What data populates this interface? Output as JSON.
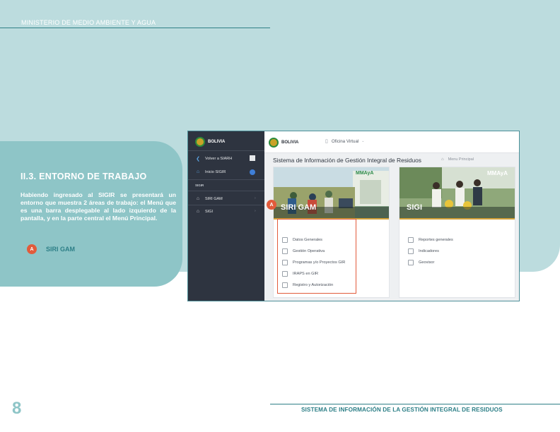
{
  "header": {
    "ministry": "MINISTERIO DE MEDIO AMBIENTE Y AGUA"
  },
  "section": {
    "title": "II.3. ENTORNO DE TRABAJO",
    "body": "Habiendo ingresado al SIGIR se presentará un entorno que muestra 2 áreas de trabajo: el Menú que es una barra desplegable al lado izquierdo de la pantalla, y en la parte central el Menú Principal.",
    "legend": {
      "badge": "A",
      "label": "SIRI GAM"
    }
  },
  "screenshot": {
    "sidebar": {
      "logo_word": "BOLIVIA",
      "back": "Volver a SIARH",
      "home": "Inicio SIGIR",
      "section_label": "SIGIR",
      "items": [
        "SIRI GAM",
        "SIGI"
      ]
    },
    "topbar": {
      "logo_word": "BOLIVIA",
      "office": "Oficina Virtual"
    },
    "title": "Sistema de Información de Gestión Integral de Residuos",
    "breadcrumb": "Menu Principal",
    "cards": [
      {
        "label": "SIRI GAM",
        "brand": "MMAyA",
        "items": [
          "Datos Generales",
          "Gestión Operativa",
          "Programas y/o Proyectos GIR",
          "IRAPS en GIR",
          "Registro y Autorización"
        ]
      },
      {
        "label": "SIGI",
        "brand": "MMAyA",
        "items": [
          "Reportes generales",
          "Indicadores",
          "Geovisor"
        ]
      }
    ],
    "badge": "A"
  },
  "footer": {
    "system_name": "SISTEMA DE INFORMACIÓN DE LA GESTIÓN INTEGRAL DE RESIDUOS",
    "page_number": "8"
  },
  "colors": {
    "band": "#bcdcde",
    "panel": "#8ec5c7",
    "accent": "#2d7f87",
    "badge": "#e25b3b",
    "sidebar": "#2e3440"
  }
}
